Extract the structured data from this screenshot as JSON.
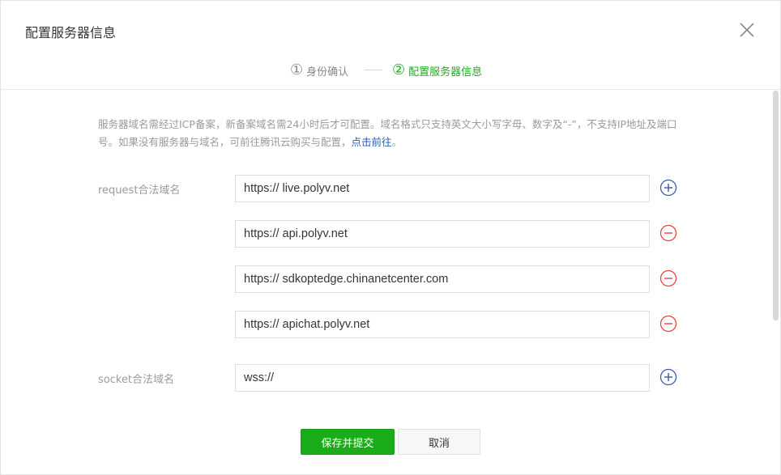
{
  "dialog": {
    "title": "配置服务器信息",
    "close_icon": "close-icon"
  },
  "steps": [
    {
      "num": "①",
      "label": "身份确认",
      "state": "done"
    },
    {
      "num": "②",
      "label": "配置服务器信息",
      "state": "active"
    }
  ],
  "notice": {
    "text": "服务器域名需经过ICP备案，新备案域名需24小时后才可配置。域名格式只支持英文大小写字母、数字及“-”，不支持IP地址及端口号。如果没有服务器与域名，可前往腾讯云购买与配置，",
    "link": "点击前往",
    "end": "。"
  },
  "request": {
    "label": "request合法域名",
    "domains": [
      "https:// live.polyv.net",
      "https:// api.polyv.net",
      "https:// sdkoptedge.chinanetcenter.com",
      "https:// apichat.polyv.net"
    ]
  },
  "socket": {
    "label": "socket合法域名",
    "value": "wss://"
  },
  "buttons": {
    "save": "保存并提交",
    "cancel": "取消"
  },
  "colors": {
    "primary": "#1aad19",
    "add_icon": "#3b5ba5",
    "remove_icon": "#e64340",
    "link": "#2a5daf"
  }
}
